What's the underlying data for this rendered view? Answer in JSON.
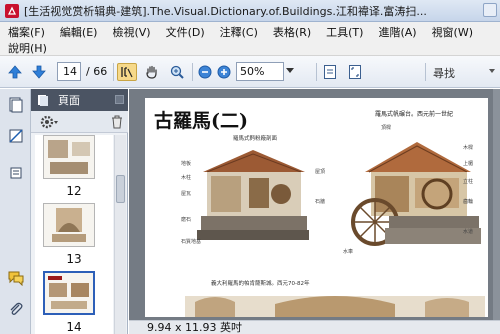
{
  "window": {
    "title": "[生活视觉赏析辑典-建筑].The.Visual.Dictionary.of.Buildings.江和禕译.富涛扫..."
  },
  "menu": {
    "items": [
      "檔案(F)",
      "編輯(E)",
      "檢視(V)",
      "文件(D)",
      "注釋(C)",
      "表格(R)",
      "工具(T)",
      "進階(A)",
      "視窗(W)"
    ],
    "help": "說明(H)"
  },
  "toolbar": {
    "current_page": "14",
    "total_pages": "/ 66",
    "zoom": "50%",
    "find_label": "尋找",
    "icons": [
      "previous-page-arrow",
      "next-page-arrow",
      "select-text-tool",
      "hand-tool",
      "zoom-tool",
      "zoom-out",
      "zoom-in",
      "fit-page",
      "full-screen"
    ]
  },
  "panel": {
    "title": "頁面",
    "thumbnails": [
      {
        "label": "12"
      },
      {
        "label": "13"
      },
      {
        "label": "14"
      }
    ]
  },
  "document": {
    "heading": "古羅馬(二)",
    "top_right_caption": "羅馬式帆碾台。西元前一世紀",
    "caption_left": "羅馬式麪粉廠剖面",
    "caption_bottom": "義大利羅馬的帕肯薩斯城。西元70-82年",
    "labels": [
      "地板",
      "木柱",
      "屋瓦",
      "屋頂",
      "石牆",
      "磨石",
      "石質地基",
      "頂樑",
      "木樑",
      "上楣",
      "立柱",
      "水道",
      "水車",
      "齒輪"
    ],
    "page_size": "9.94 x 11.93 英吋"
  },
  "colors": {
    "panel_header": "#4b5463",
    "doc_background": "#747b84",
    "selected_thumb_border": "#2d5fb8",
    "acrobat_red": "#c8102e"
  }
}
